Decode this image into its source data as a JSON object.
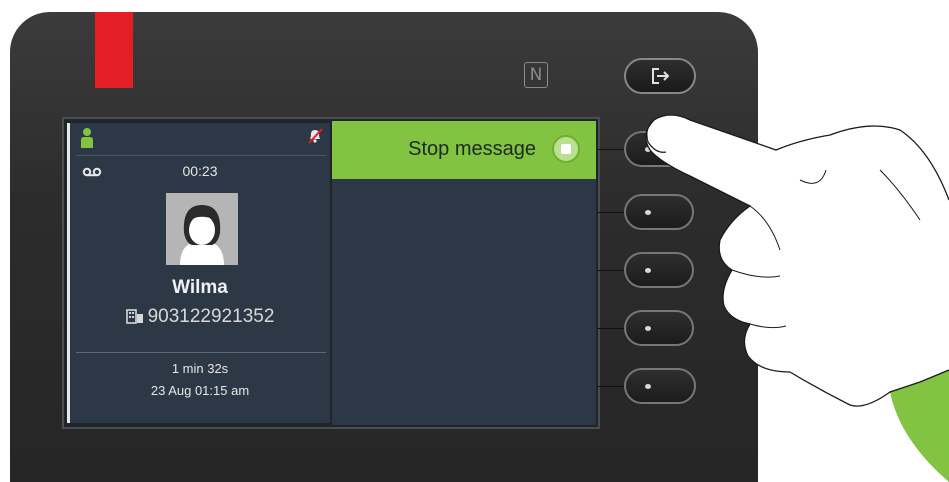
{
  "device": {
    "led_color": "#e31e24",
    "nfc_icon": "N"
  },
  "screen": {
    "call_info": {
      "presence_icon": "user-available-icon",
      "mute_icon": "ringer-off-icon",
      "voicemail_icon": "voicemail-icon",
      "elapsed": "00:23",
      "contact_name": "Wilma",
      "number_icon": "office-phone-icon",
      "number": "903122921352",
      "message_length": "1 min 32s",
      "received": "23 Aug 01:15 am"
    },
    "menu": {
      "stop_message_label": "Stop message",
      "stop_icon": "stop-icon",
      "accent": "#82c341"
    }
  },
  "keys": {
    "exit_icon": "exit-icon",
    "softkeys": [
      "softkey-1",
      "softkey-2",
      "softkey-3",
      "softkey-4",
      "softkey-5"
    ]
  }
}
